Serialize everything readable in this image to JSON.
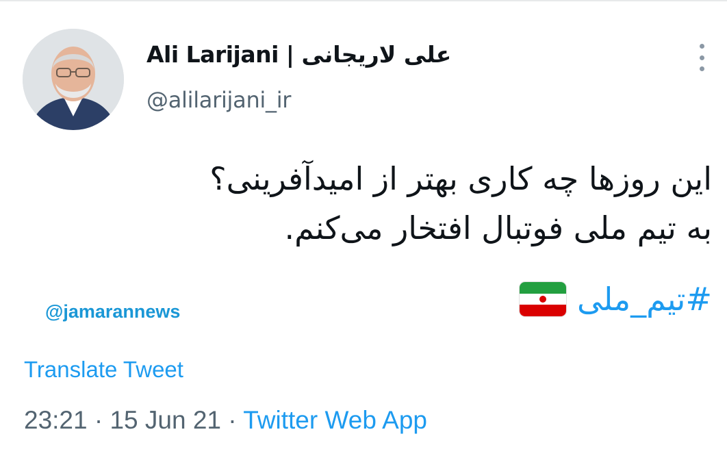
{
  "author": {
    "display_name": "Ali Larijani | علی لاریجانی",
    "handle": "@alilarijani_ir"
  },
  "tweet": {
    "lines": [
      "این روزها چه کاری بهتر از امیدآفرینی؟",
      "به تیم ملی فوتبال افتخار می‌کنم."
    ],
    "hashtag": "#تیم_ملی",
    "flag_icon": "iran-flag-icon"
  },
  "watermark": "@jamarannews",
  "translate_label": "Translate Tweet",
  "meta": {
    "time": "23:21",
    "separator": "·",
    "date": "15 Jun 21",
    "source": "Twitter Web App"
  },
  "colors": {
    "link": "#1d9bf0",
    "secondary_text": "#536471",
    "watermark": "#1a97d6"
  },
  "icons": [
    "more-options-icon",
    "avatar",
    "iran-flag-icon"
  ]
}
